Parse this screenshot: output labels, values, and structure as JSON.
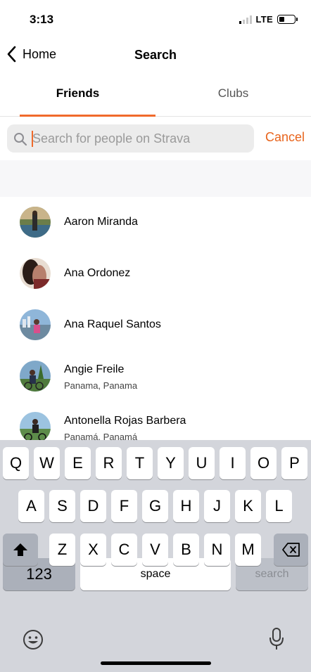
{
  "status_bar": {
    "time": "3:13",
    "network": "LTE",
    "signal_bars_active": 1,
    "signal_bars_total": 4,
    "battery_level": 0.35
  },
  "nav": {
    "back_label": "Home",
    "title": "Search"
  },
  "tabs": [
    {
      "label": "Friends",
      "selected": true
    },
    {
      "label": "Clubs",
      "selected": false
    }
  ],
  "search": {
    "placeholder": "Search for people on Strava",
    "value": "",
    "cancel_label": "Cancel"
  },
  "athletes": [
    {
      "name": "Aaron Miranda",
      "location": ""
    },
    {
      "name": "Ana Ordonez",
      "location": ""
    },
    {
      "name": "Ana Raquel Santos",
      "location": ""
    },
    {
      "name": "Angie Freile",
      "location": "Panama, Panama"
    },
    {
      "name": "Antonella Rojas Barbera",
      "location": "Panamá, Panamá"
    }
  ],
  "keyboard": {
    "row1": [
      "Q",
      "W",
      "E",
      "R",
      "T",
      "Y",
      "U",
      "I",
      "O",
      "P"
    ],
    "row2": [
      "A",
      "S",
      "D",
      "F",
      "G",
      "H",
      "J",
      "K",
      "L"
    ],
    "row3": [
      "Z",
      "X",
      "C",
      "V",
      "B",
      "N",
      "M"
    ],
    "numbers_label": "123",
    "space_label": "space",
    "search_label": "search"
  },
  "colors": {
    "accent": "#f06a2b",
    "cancel": "#e8641c",
    "keyboard_bg": "#d3d5db"
  }
}
